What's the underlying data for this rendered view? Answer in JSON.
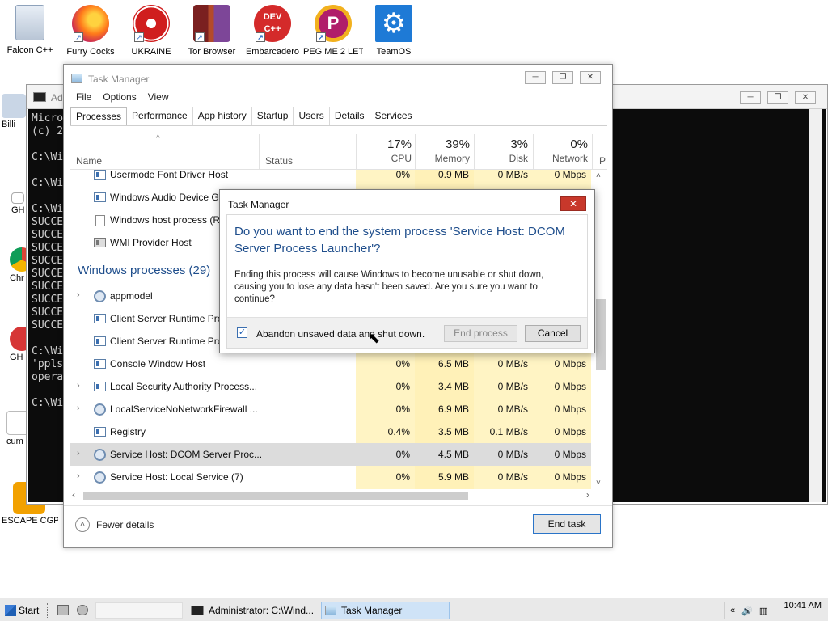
{
  "desktop": {
    "top_icons": [
      {
        "label": "Falcon C++",
        "icon": "recycle-bin-icon"
      },
      {
        "label": "Furry Cocks",
        "icon": "firefox-icon"
      },
      {
        "label": "UKRAINE",
        "icon": "radiation-icon"
      },
      {
        "label": "Tor Browser",
        "icon": "tor-browser-icon"
      },
      {
        "label": "Embarcadero",
        "icon": "dev-cpp-icon"
      },
      {
        "label": "PEG ME 2 LET",
        "icon": "peg-icon"
      },
      {
        "label": "TeamOS",
        "icon": "gear-icon"
      }
    ],
    "side_icons": [
      {
        "label": "Billi"
      },
      {
        "label": "GH"
      },
      {
        "label": "Chr"
      },
      {
        "label": "GH"
      },
      {
        "label": "cum"
      },
      {
        "label": "ESCAPE CGP"
      }
    ]
  },
  "console": {
    "title": "Ad",
    "lines": [
      "Micro",
      "(c) 2",
      "",
      "C:\\Wi",
      "",
      "C:\\Wi",
      "",
      "C:\\Wi",
      "SUCCE",
      "SUCCE",
      "SUCCE",
      "SUCCE",
      "SUCCE",
      "SUCCE",
      "SUCCE",
      "SUCCE",
      "SUCCE",
      "",
      "C:\\Wi",
      "'ppls",
      "opera",
      "",
      "C:\\Wi"
    ]
  },
  "taskmanager": {
    "title": "Task Manager",
    "menu": [
      "File",
      "Options",
      "View"
    ],
    "tabs": [
      "Processes",
      "Performance",
      "App history",
      "Startup",
      "Users",
      "Details",
      "Services"
    ],
    "columns": {
      "name": "Name",
      "status": "Status",
      "cpu": {
        "pct": "17%",
        "label": "CPU"
      },
      "memory": {
        "pct": "39%",
        "label": "Memory"
      },
      "disk": {
        "pct": "3%",
        "label": "Disk"
      },
      "network": {
        "pct": "0%",
        "label": "Network"
      },
      "power": "P"
    },
    "rows_top": [
      {
        "name": "Usermode Font Driver Host",
        "cpu": "0%",
        "mem": "0.9 MB",
        "disk": "0 MB/s",
        "net": "0 Mbps"
      },
      {
        "name": "Windows Audio Device G"
      },
      {
        "name": "Windows host process (R"
      },
      {
        "name": "WMI Provider Host"
      }
    ],
    "group": "Windows processes (29)",
    "rows_win": [
      {
        "name": "appmodel"
      },
      {
        "name": "Client Server Runtime Pro"
      },
      {
        "name": "Client Server Runtime Pro"
      },
      {
        "name": "Console Window Host",
        "cpu": "0%",
        "mem": "6.5 MB",
        "disk": "0 MB/s",
        "net": "0 Mbps"
      },
      {
        "name": "Local Security Authority Process...",
        "cpu": "0%",
        "mem": "3.4 MB",
        "disk": "0 MB/s",
        "net": "0 Mbps"
      },
      {
        "name": "LocalServiceNoNetworkFirewall ...",
        "cpu": "0%",
        "mem": "6.9 MB",
        "disk": "0 MB/s",
        "net": "0 Mbps"
      },
      {
        "name": "Registry",
        "cpu": "0.4%",
        "mem": "3.5 MB",
        "disk": "0.1 MB/s",
        "net": "0 Mbps"
      },
      {
        "name": "Service Host: DCOM Server Proc...",
        "cpu": "0%",
        "mem": "4.5 MB",
        "disk": "0 MB/s",
        "net": "0 Mbps"
      },
      {
        "name": "Service Host: Local Service (7)",
        "cpu": "0%",
        "mem": "5.9 MB",
        "disk": "0 MB/s",
        "net": "0 Mbps"
      }
    ],
    "fewer_details": "Fewer details",
    "end_task": "End task"
  },
  "dialog": {
    "title": "Task Manager",
    "question": "Do you want to end the system process 'Service Host: DCOM Server Process Launcher'?",
    "message": "Ending this process will cause Windows to become unusable or shut down, causing you to lose any data hasn't been saved. Are you sure you want to continue?",
    "checkbox_label": "Abandon unsaved data and shut down.",
    "end_process": "End process",
    "cancel": "Cancel"
  },
  "taskbar": {
    "start": "Start",
    "task_console": "Administrator: C:\\Wind...",
    "task_manager": "Task Manager",
    "tray_chevron": "«",
    "clock_time": "10:41 AM"
  }
}
